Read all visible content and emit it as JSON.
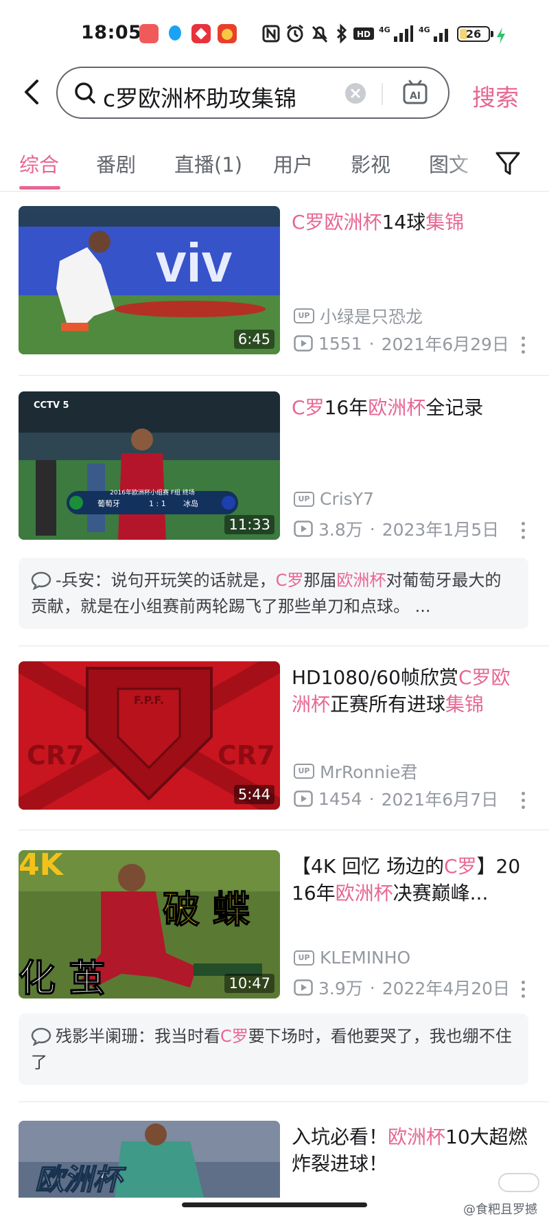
{
  "status_bar": {
    "time": "18:05",
    "battery": "26",
    "battery_level": 0.26,
    "icons": [
      "app-icon-red",
      "qq-icon",
      "app-icon-checker",
      "app-icon-coin",
      "nfc-icon",
      "alarm-icon",
      "mute-icon",
      "bluetooth-icon",
      "hd-icon",
      "signal-icon",
      "signal-icon",
      "battery-icon",
      "charging-icon"
    ]
  },
  "search": {
    "query": "c罗欧洲杯助攻集锦",
    "submit_label": "搜索"
  },
  "tabs": [
    {
      "label": "综合",
      "active": true
    },
    {
      "label": "番剧",
      "active": false
    },
    {
      "label": "直播(1)",
      "active": false
    },
    {
      "label": "用户",
      "active": false
    },
    {
      "label": "影视",
      "active": false
    },
    {
      "label": "图文",
      "active": false
    }
  ],
  "results": [
    {
      "title_parts": [
        [
          "C罗欧洲杯",
          true
        ],
        [
          "14球",
          false
        ],
        [
          "集锦",
          true
        ]
      ],
      "duration": "6:45",
      "up_name": "小绿是只恐龙",
      "views": "1551",
      "date": "2021年6月29日"
    },
    {
      "title_parts": [
        [
          "C罗",
          true
        ],
        [
          "16年",
          false
        ],
        [
          "欧洲杯",
          true
        ],
        [
          "全记录",
          false
        ]
      ],
      "duration": "11:33",
      "up_name": "CrisY7",
      "views": "3.8万",
      "date": "2023年1月5日",
      "comment": {
        "parts": [
          [
            "-兵安：说句开玩笑的话就是，",
            false
          ],
          [
            "C罗",
            true
          ],
          [
            "那届",
            false
          ],
          [
            "欧洲杯",
            true
          ],
          [
            "对葡萄牙最大的贡献，就是在小组赛前两轮踢飞了那些单刀和点球。 ...",
            false
          ]
        ]
      }
    },
    {
      "title_parts": [
        [
          "HD1080/60帧欣赏",
          false
        ],
        [
          "C罗欧洲杯",
          true
        ],
        [
          "正赛所有进球",
          false
        ],
        [
          "集锦",
          true
        ]
      ],
      "duration": "5:44",
      "up_name": "MrRonnie君",
      "views": "1454",
      "date": "2021年6月7日"
    },
    {
      "title_parts": [
        [
          "【4K 回忆 场边的",
          false
        ],
        [
          "C罗",
          true
        ],
        [
          "】2016年",
          false
        ],
        [
          "欧洲杯",
          true
        ],
        [
          "决赛巅峰...",
          false
        ]
      ],
      "duration": "10:47",
      "up_name": "KLEMINHO",
      "views": "3.9万",
      "date": "2022年4月20日",
      "comment": {
        "parts": [
          [
            "残影半阑珊：我当时看",
            false
          ],
          [
            "C罗",
            true
          ],
          [
            "要下场时，看他要哭了，我也绷不住了",
            false
          ]
        ]
      }
    },
    {
      "title_parts": [
        [
          "入坑必看！",
          false
        ],
        [
          "欧洲杯",
          true
        ],
        [
          "10大超燃炸裂进球！",
          false
        ]
      ]
    }
  ],
  "thumb_text": {
    "scoreboard_teams": [
      "葡萄牙",
      "1 : 1",
      "冰岛"
    ],
    "scoreboard_caption": "2016年欧洲杯小组赛 F组 终场",
    "cctv": "CCTV 5",
    "cr7": "CR7",
    "fpf": "F.P.F.",
    "k4": "4K",
    "big_char_1": "破 蝶",
    "big_char_2": "化 茧",
    "euro_label": "欧洲杯",
    "viv": "viv"
  },
  "watermark": "@食粑且罗撼",
  "labels": {
    "up": "UP"
  },
  "colors": {
    "accent": "#e76694",
    "text": "#18191c",
    "secondary": "#9499a0"
  }
}
